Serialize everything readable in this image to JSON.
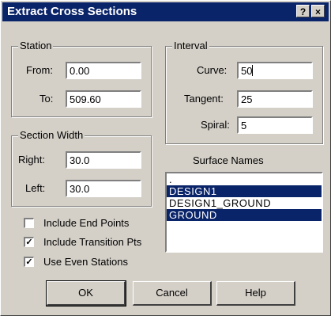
{
  "window": {
    "title": "Extract Cross Sections",
    "help_button": "?",
    "close_button": "×"
  },
  "station": {
    "legend": "Station",
    "from_label": "From:",
    "from_value": "0.00",
    "to_label": "To:",
    "to_value": "509.60"
  },
  "interval": {
    "legend": "Interval",
    "curve_label": "Curve:",
    "curve_value": "50",
    "tangent_label": "Tangent:",
    "tangent_value": "25",
    "spiral_label": "Spiral:",
    "spiral_value": "5"
  },
  "section_width": {
    "legend": "Section Width",
    "right_label": "Right:",
    "right_value": "30.0",
    "left_label": "Left:",
    "left_value": "30.0"
  },
  "surface_names": {
    "label": "Surface Names",
    "items": [
      {
        "text": ".",
        "selected": false
      },
      {
        "text": "DESIGN1",
        "selected": true
      },
      {
        "text": "DESIGN1_GROUND",
        "selected": false
      },
      {
        "text": "GROUND",
        "selected": true
      }
    ]
  },
  "options": {
    "include_end_points": {
      "label": "Include End Points",
      "checked": false
    },
    "include_transition_pts": {
      "label": "Include Transition Pts",
      "checked": true
    },
    "use_even_stations": {
      "label": "Use Even Stations",
      "checked": true
    }
  },
  "buttons": {
    "ok": "OK",
    "cancel": "Cancel",
    "help": "Help"
  }
}
